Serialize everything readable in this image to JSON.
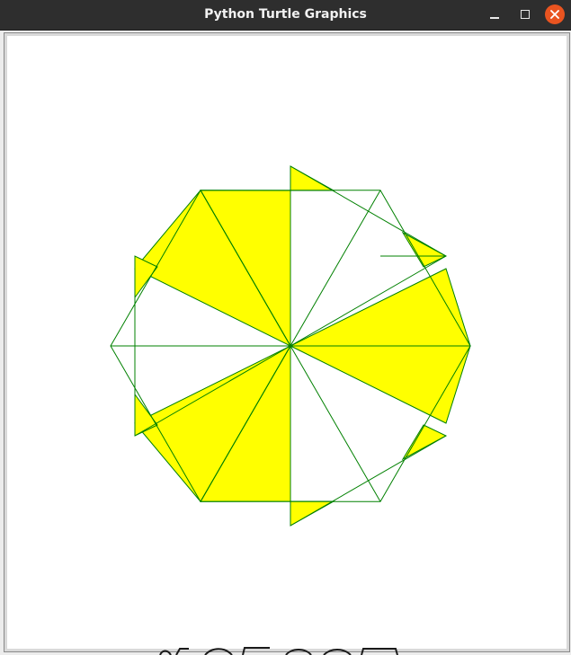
{
  "window": {
    "title": "Python Turtle Graphics",
    "controls": {
      "minimize_icon": "minimize-icon",
      "maximize_icon": "maximize-icon",
      "close_icon": "close-icon"
    }
  },
  "canvas": {
    "background": "#ffffff",
    "fill_color": "#ffff00",
    "pen_color": "#008000"
  },
  "theme": {
    "titlebar_color": "#2e2e2e",
    "close_button_color": "#e95420"
  }
}
